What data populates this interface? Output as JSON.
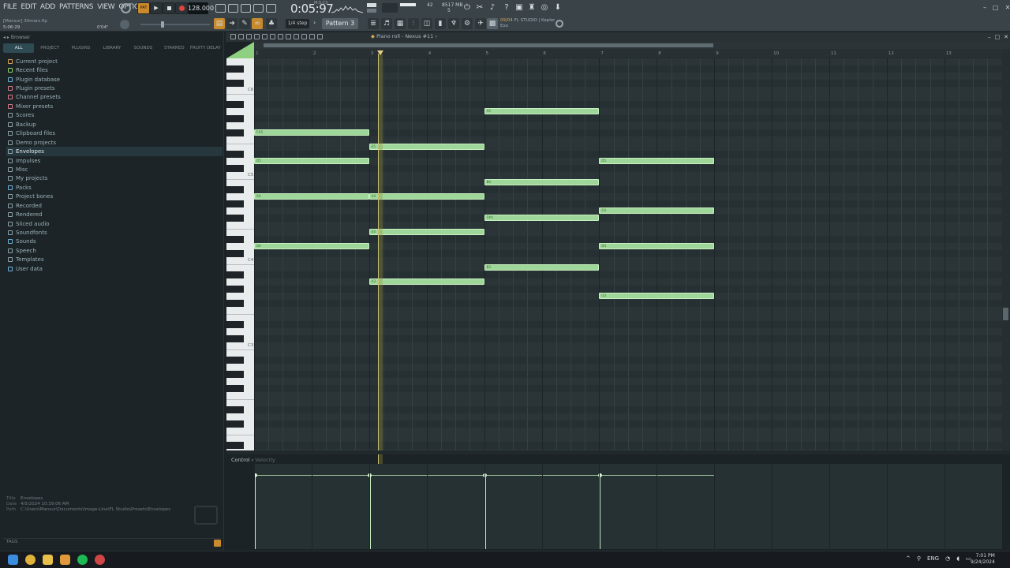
{
  "menu": [
    "FILE",
    "EDIT",
    "ADD",
    "PATTERNS",
    "VIEW",
    "OPTIONS",
    "TOOLS",
    "HELP"
  ],
  "transport": {
    "pat_label": "PAT",
    "tempo": "128.000",
    "time": "0:05:97",
    "time_unit": "M:S:CS",
    "cpu_mem": "8517 MB",
    "cpu_val": "42",
    "cpu_sub": "5"
  },
  "song": {
    "file": "[Mansur] 30mars.flp",
    "position": "5:06:29",
    "length": "0'04\""
  },
  "toolbar": {
    "snap": "1/4 step",
    "pattern": "Pattern 3"
  },
  "news": {
    "date": "09/04",
    "headline": "FL STUDIO | Kepler",
    "sub": "Exo"
  },
  "browser": {
    "title": "Browser",
    "tabs": [
      "ALL",
      "PROJECT",
      "PLUGINS",
      "LIBRARY",
      "SOUNDS",
      "STARRED",
      "FRUITY DELAY"
    ],
    "items": [
      {
        "label": "Current project",
        "color": "#d9a25a"
      },
      {
        "label": "Recent files",
        "color": "#8fd36b"
      },
      {
        "label": "Plugin database",
        "color": "#6fb3d9"
      },
      {
        "label": "Plugin presets",
        "color": "#d97a8c"
      },
      {
        "label": "Channel presets",
        "color": "#d97a8c"
      },
      {
        "label": "Mixer presets",
        "color": "#d97a8c"
      },
      {
        "label": "Scores",
        "color": "#8da3ab"
      },
      {
        "label": "Backup",
        "color": "#8da3ab"
      },
      {
        "label": "Clipboard files",
        "color": "#8da3ab"
      },
      {
        "label": "Demo projects",
        "color": "#8da3ab"
      },
      {
        "label": "Envelopes",
        "color": "#8da3ab"
      },
      {
        "label": "Impulses",
        "color": "#8da3ab"
      },
      {
        "label": "Misc",
        "color": "#8da3ab"
      },
      {
        "label": "My projects",
        "color": "#8da3ab"
      },
      {
        "label": "Packs",
        "color": "#6fb3d9"
      },
      {
        "label": "Project bones",
        "color": "#8da3ab"
      },
      {
        "label": "Recorded",
        "color": "#8da3ab"
      },
      {
        "label": "Rendered",
        "color": "#8da3ab"
      },
      {
        "label": "Sliced audio",
        "color": "#8da3ab"
      },
      {
        "label": "Soundfonts",
        "color": "#8da3ab"
      },
      {
        "label": "Sounds",
        "color": "#6fb3d9"
      },
      {
        "label": "Speech",
        "color": "#8da3ab"
      },
      {
        "label": "Templates",
        "color": "#8da3ab"
      },
      {
        "label": "User data",
        "color": "#6fb3d9"
      }
    ],
    "selected_index": 10,
    "info": {
      "title_label": "Title",
      "title": "Envelopes",
      "date_label": "Date",
      "date": "4/5/2024 10:39:06 AM",
      "path_label": "Path",
      "path": "C:\\Users\\Mansur\\Documents\\Image-Line\\FL Studio\\Presets\\Envelopes"
    },
    "tags": "TAGS"
  },
  "piano_roll": {
    "title": "Piano roll - Nexus #11",
    "bars": [
      "1",
      "2",
      "3",
      "4",
      "5",
      "6",
      "7",
      "8",
      "9",
      "10",
      "11",
      "12",
      "13"
    ],
    "key_labels": [
      "C6",
      "C5",
      "C4",
      "C3"
    ],
    "notes": [
      {
        "label": "F#5",
        "bar": 1,
        "len": 2,
        "pitch": 78
      },
      {
        "label": "D5",
        "bar": 1,
        "len": 2,
        "pitch": 74
      },
      {
        "label": "A4",
        "bar": 1,
        "len": 2,
        "pitch": 69
      },
      {
        "label": "D4",
        "bar": 1,
        "len": 2,
        "pitch": 62
      },
      {
        "label": "E5",
        "bar": 3,
        "len": 2,
        "pitch": 76
      },
      {
        "label": "A4",
        "bar": 3,
        "len": 2,
        "pitch": 69
      },
      {
        "label": "E4",
        "bar": 3,
        "len": 2,
        "pitch": 64
      },
      {
        "label": "A3",
        "bar": 3,
        "len": 2,
        "pitch": 57
      },
      {
        "label": "A5",
        "bar": 5,
        "len": 2,
        "pitch": 81
      },
      {
        "label": "B4",
        "bar": 5,
        "len": 2,
        "pitch": 71
      },
      {
        "label": "F#4",
        "bar": 5,
        "len": 2,
        "pitch": 66
      },
      {
        "label": "B3",
        "bar": 5,
        "len": 2,
        "pitch": 59
      },
      {
        "label": "D5",
        "bar": 7,
        "len": 2,
        "pitch": 74
      },
      {
        "label": "G4",
        "bar": 7,
        "len": 2,
        "pitch": 67
      },
      {
        "label": "D4",
        "bar": 7,
        "len": 2,
        "pitch": 62
      },
      {
        "label": "G3",
        "bar": 7,
        "len": 2,
        "pitch": 55
      }
    ],
    "playhead_bar": 3.15,
    "control_label": "Control",
    "control_sub": "Velocity"
  },
  "taskbar": {
    "lang": "ENG",
    "time": "7:01 PM",
    "date": "9/24/2024"
  },
  "colors": {
    "note_fill": "#9fd79a",
    "accent": "#c88a2c",
    "grid": "#2b3437"
  }
}
